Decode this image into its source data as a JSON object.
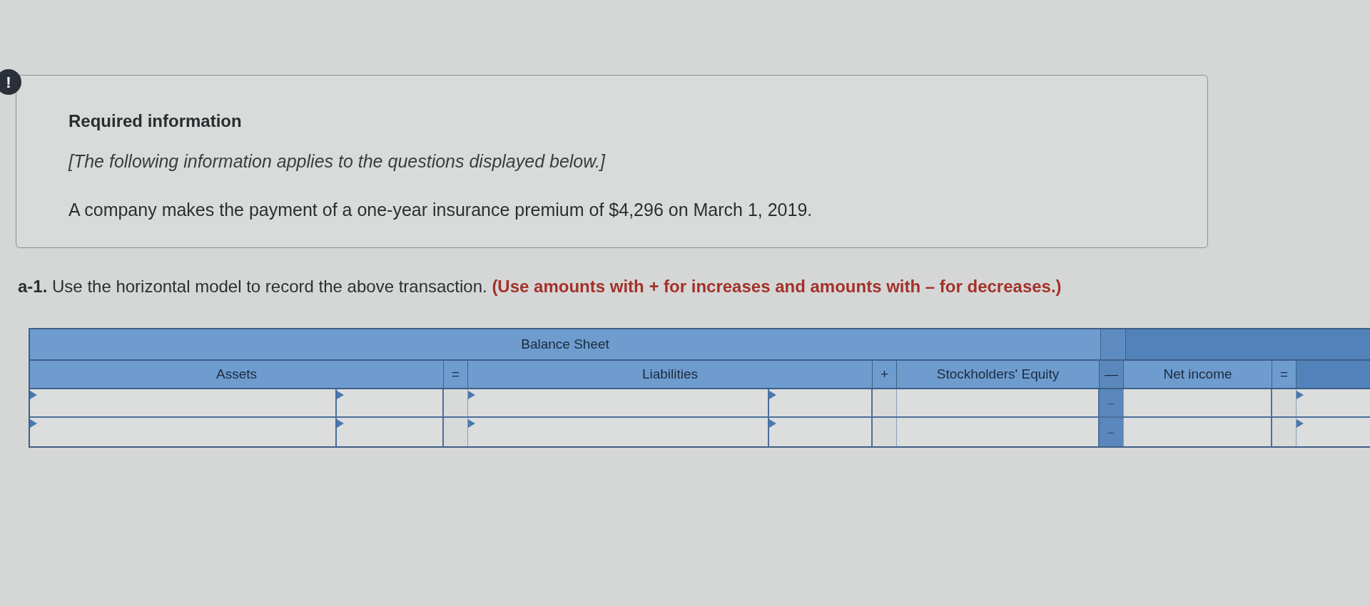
{
  "alert": {
    "symbol": "!"
  },
  "info": {
    "title": "Required information",
    "note": "[The following information applies to the questions displayed below.]",
    "text": "A company makes the payment of a one-year insurance premium of $4,296 on March 1, 2019."
  },
  "question": {
    "label": "a-1.",
    "text": "Use the horizontal model to record the above transaction.",
    "instruction": "(Use amounts with + for increases and amounts with – for decreases.)"
  },
  "table": {
    "group_header": "Balance Sheet",
    "columns": [
      {
        "kind": "pair",
        "label": "Assets"
      },
      {
        "kind": "operator",
        "label": "=",
        "shaded": false
      },
      {
        "kind": "pair",
        "label": "Liabilities"
      },
      {
        "kind": "operator",
        "label": "+",
        "shaded": false
      },
      {
        "kind": "field",
        "label": "Stockholders' Equity"
      },
      {
        "kind": "operator",
        "label": "—",
        "shaded": true
      },
      {
        "kind": "field",
        "label": "Net income"
      },
      {
        "kind": "operator",
        "label": "=",
        "shaded": false
      },
      {
        "kind": "select"
      }
    ],
    "rows": [
      {
        "sign": "–"
      },
      {
        "sign": "–"
      }
    ]
  }
}
